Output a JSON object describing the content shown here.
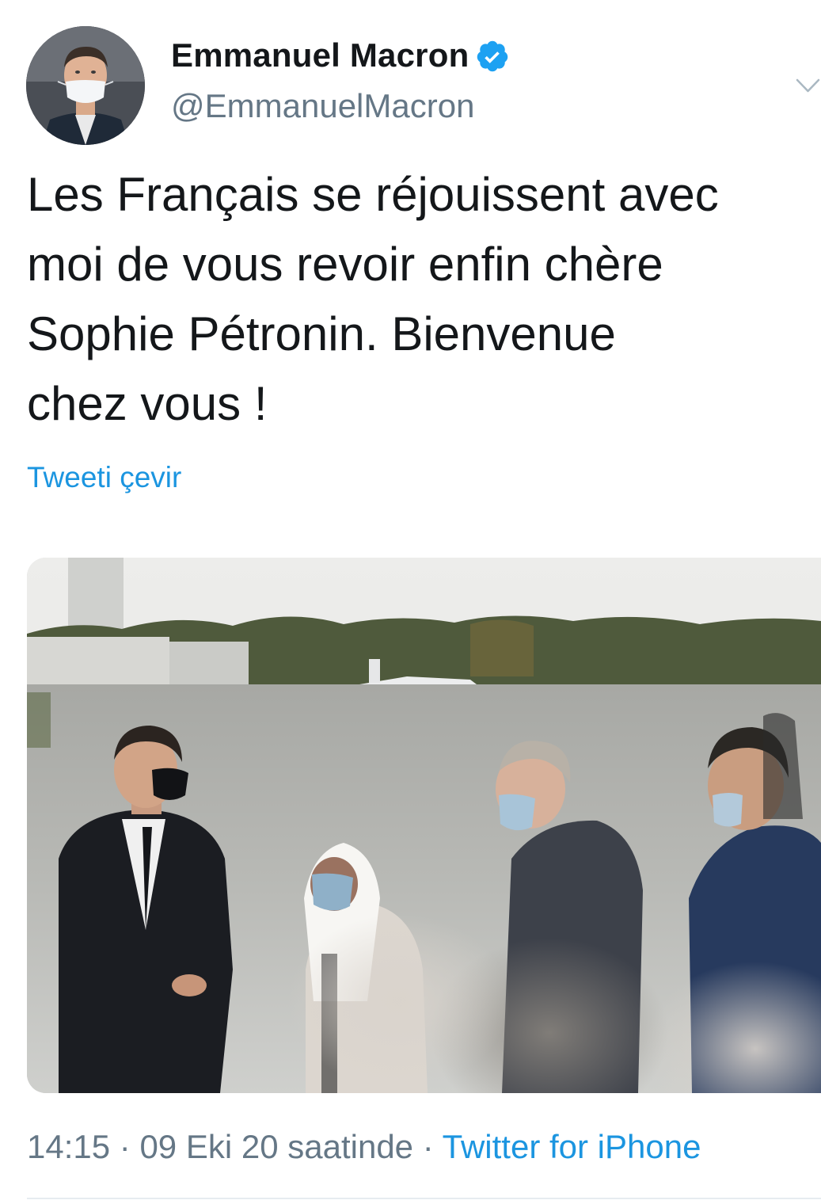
{
  "user": {
    "display_name": "Emmanuel Macron",
    "handle": "@EmmanuelMacron",
    "verified": true,
    "avatar_icon": "profile-photo"
  },
  "tweet": {
    "text": "Les Français se réjouissent avec\nmoi de vous revoir enfin chère\nSophie Pétronin. Bienvenue\nchez vous !",
    "translate_label": "Tweeti çevir"
  },
  "meta": {
    "time": "14:15",
    "date": "09 Eki 20 saatinde",
    "separator": "·",
    "source": "Twitter for iPhone"
  },
  "icons": {
    "verified": "verified-badge-icon",
    "more": "chevron-down-icon"
  },
  "colors": {
    "link": "#1b95e0",
    "secondary_text": "#657786",
    "primary_text": "#14171a",
    "verified": "#1da1f2"
  }
}
